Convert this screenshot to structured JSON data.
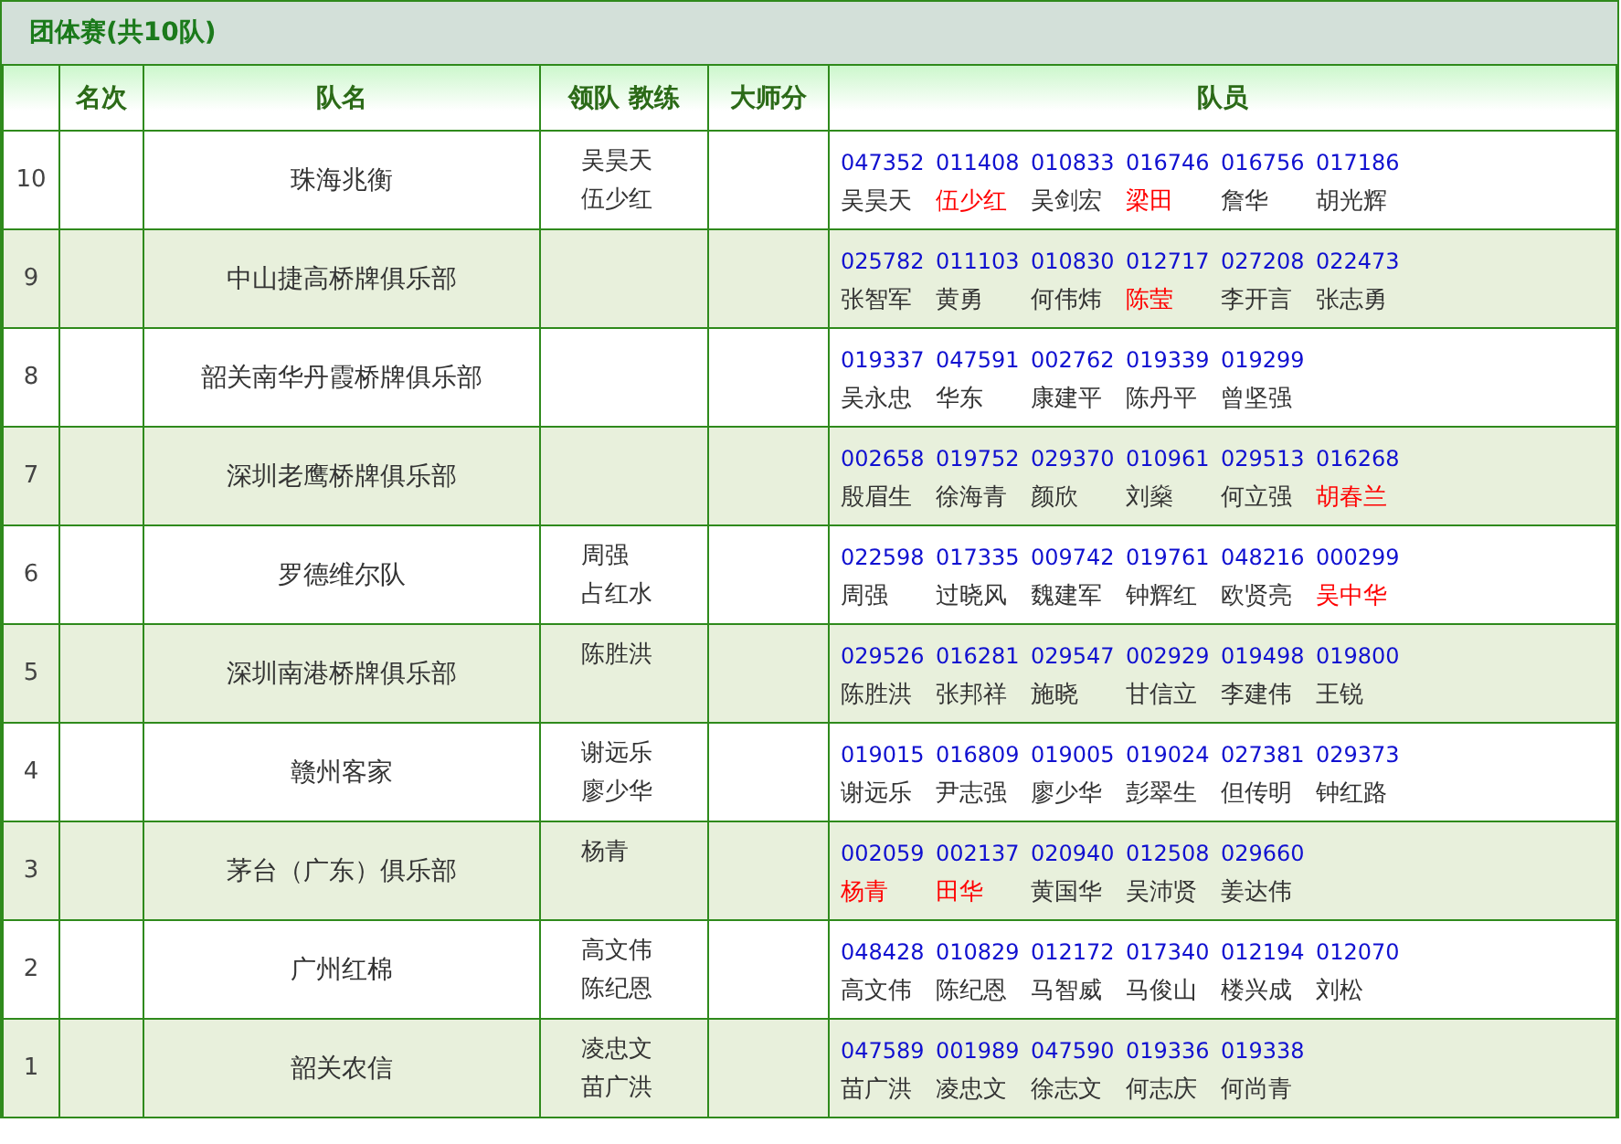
{
  "title": "团体赛(共10队)",
  "columns": [
    "名次",
    "队名",
    "领队 教练",
    "大师分",
    "队员"
  ],
  "rows": [
    {
      "column_1": "10",
      "team": "珠海兆衡",
      "leaders": [
        "吴昊天",
        "伍少红"
      ],
      "members": [
        {
          "id": "047352",
          "name": "吴昊天",
          "color": "#333333"
        },
        {
          "id": "011408",
          "name": "伍少红",
          "color": "#ff0000"
        },
        {
          "id": "010833",
          "name": "吴剑宏",
          "color": "#333333"
        },
        {
          "id": "016746",
          "name": "梁田",
          "color": "#ff0000"
        },
        {
          "id": "016756",
          "name": "詹华",
          "color": "#333333"
        },
        {
          "id": "017186",
          "name": "胡光辉",
          "color": "#333333"
        }
      ]
    },
    {
      "column_1": "9",
      "team": "中山捷高桥牌俱乐部",
      "leaders": [],
      "members": [
        {
          "id": "025782",
          "name": "张智军",
          "color": "#333333"
        },
        {
          "id": "011103",
          "name": "黄勇",
          "color": "#333333"
        },
        {
          "id": "010830",
          "name": "何伟炜",
          "color": "#333333"
        },
        {
          "id": "012717",
          "name": "陈莹",
          "color": "#ff0000"
        },
        {
          "id": "027208",
          "name": "李开言",
          "color": "#333333"
        },
        {
          "id": "022473",
          "name": "张志勇",
          "color": "#333333"
        }
      ]
    },
    {
      "column_1": "8",
      "team": "韶关南华丹霞桥牌俱乐部",
      "leaders": [],
      "members": [
        {
          "id": "019337",
          "name": "吴永忠",
          "color": "#333333"
        },
        {
          "id": "047591",
          "name": "华东",
          "color": "#333333"
        },
        {
          "id": "002762",
          "name": "康建平",
          "color": "#333333"
        },
        {
          "id": "019339",
          "name": "陈丹平",
          "color": "#333333"
        },
        {
          "id": "019299",
          "name": "曾坚强",
          "color": "#333333"
        }
      ]
    },
    {
      "column_1": "7",
      "team": "深圳老鹰桥牌俱乐部",
      "leaders": [],
      "members": [
        {
          "id": "002658",
          "name": "殷眉生",
          "color": "#333333"
        },
        {
          "id": "019752",
          "name": "徐海青",
          "color": "#333333"
        },
        {
          "id": "029370",
          "name": "颜欣",
          "color": "#333333"
        },
        {
          "id": "010961",
          "name": "刘燊",
          "color": "#333333"
        },
        {
          "id": "029513",
          "name": "何立强",
          "color": "#333333"
        },
        {
          "id": "016268",
          "name": "胡春兰",
          "color": "#ff0000"
        }
      ]
    },
    {
      "column_1": "6",
      "team": "罗德维尔队",
      "leaders": [
        "周强",
        "占红水"
      ],
      "members": [
        {
          "id": "022598",
          "name": "周强",
          "color": "#333333"
        },
        {
          "id": "017335",
          "name": "过晓风",
          "color": "#333333"
        },
        {
          "id": "009742",
          "name": "魏建军",
          "color": "#333333"
        },
        {
          "id": "019761",
          "name": "钟辉红",
          "color": "#333333"
        },
        {
          "id": "048216",
          "name": "欧贤亮",
          "color": "#333333"
        },
        {
          "id": "000299",
          "name": "吴中华",
          "color": "#ff0000"
        }
      ]
    },
    {
      "column_1": "5",
      "team": "深圳南港桥牌俱乐部",
      "leaders": [
        "陈胜洪"
      ],
      "members": [
        {
          "id": "029526",
          "name": "陈胜洪",
          "color": "#333333"
        },
        {
          "id": "016281",
          "name": "张邦祥",
          "color": "#333333"
        },
        {
          "id": "029547",
          "name": "施晓",
          "color": "#333333"
        },
        {
          "id": "002929",
          "name": "甘信立",
          "color": "#333333"
        },
        {
          "id": "019498",
          "name": "李建伟",
          "color": "#333333"
        },
        {
          "id": "019800",
          "name": "王锐",
          "color": "#333333"
        }
      ]
    },
    {
      "column_1": "4",
      "team": "赣州客家",
      "leaders": [
        "谢远乐",
        "廖少华"
      ],
      "members": [
        {
          "id": "019015",
          "name": "谢远乐",
          "color": "#333333"
        },
        {
          "id": "016809",
          "name": "尹志强",
          "color": "#333333"
        },
        {
          "id": "019005",
          "name": "廖少华",
          "color": "#333333"
        },
        {
          "id": "019024",
          "name": "彭翠生",
          "color": "#333333"
        },
        {
          "id": "027381",
          "name": "但传明",
          "color": "#333333"
        },
        {
          "id": "029373",
          "name": "钟红路",
          "color": "#333333"
        }
      ]
    },
    {
      "column_1": "3",
      "team": "茅台（广东）俱乐部",
      "leaders": [
        "杨青"
      ],
      "members": [
        {
          "id": "002059",
          "name": "杨青",
          "color": "#ff0000"
        },
        {
          "id": "002137",
          "name": "田华",
          "color": "#ff0000"
        },
        {
          "id": "020940",
          "name": "黄国华",
          "color": "#333333"
        },
        {
          "id": "012508",
          "name": "吴沛贤",
          "color": "#333333"
        },
        {
          "id": "029660",
          "name": "姜达伟",
          "color": "#333333"
        }
      ]
    },
    {
      "column_1": "2",
      "team": "广州红棉",
      "leaders": [
        "高文伟",
        "陈纪恩"
      ],
      "members": [
        {
          "id": "048428",
          "name": "高文伟",
          "color": "#333333"
        },
        {
          "id": "010829",
          "name": "陈纪恩",
          "color": "#333333"
        },
        {
          "id": "012172",
          "name": "马智威",
          "color": "#333333"
        },
        {
          "id": "017340",
          "name": "马俊山",
          "color": "#333333"
        },
        {
          "id": "012194",
          "name": "楼兴成",
          "color": "#333333"
        },
        {
          "id": "012070",
          "name": "刘松",
          "color": "#333333"
        }
      ]
    },
    {
      "column_1": "1",
      "team": "韶关农信",
      "leaders": [
        "凌忠文",
        "苗广洪"
      ],
      "members": [
        {
          "id": "047589",
          "name": "苗广洪",
          "color": "#333333"
        },
        {
          "id": "001989",
          "name": "凌忠文",
          "color": "#333333"
        },
        {
          "id": "047590",
          "name": "徐志文",
          "color": "#333333"
        },
        {
          "id": "019336",
          "name": "何志庆",
          "color": "#333333"
        },
        {
          "id": "019338",
          "name": "何尚青",
          "color": "#333333"
        }
      ]
    }
  ]
}
